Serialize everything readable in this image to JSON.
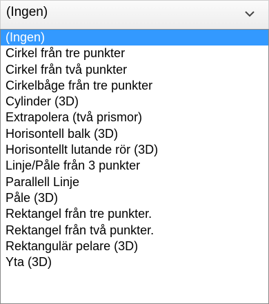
{
  "combobox": {
    "selected_value": "(Ingen)",
    "arrow_icon": "chevron-down-icon"
  },
  "dropdown": {
    "selected_index": 0,
    "selection_color": "#3399ff",
    "options": [
      "(Ingen)",
      "Cirkel från tre punkter",
      "Cirkel från två punkter",
      "Cirkelbåge från tre punkter",
      "Cylinder (3D)",
      "Extrapolera (två prismor)",
      "Horisontell balk (3D)",
      "Horisontellt lutande rör (3D)",
      "Linje/Påle från 3 punkter",
      "Parallell Linje",
      "Påle (3D)",
      "Rektangel från tre punkter.",
      "Rektangel från två punkter.",
      "Rektangulär pelare (3D)",
      "Yta (3D)"
    ]
  }
}
